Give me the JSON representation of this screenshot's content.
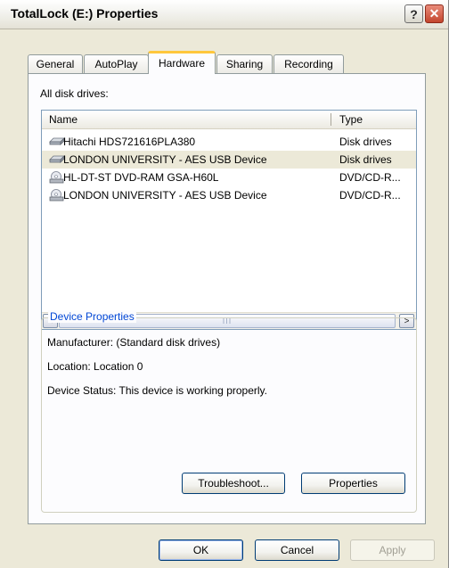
{
  "window": {
    "title": "TotalLock (E:) Properties"
  },
  "tabs": [
    {
      "label": "General"
    },
    {
      "label": "AutoPlay"
    },
    {
      "label": "Hardware"
    },
    {
      "label": "Sharing"
    },
    {
      "label": "Recording"
    }
  ],
  "active_tab": "Hardware",
  "drives": {
    "label": "All disk drives:",
    "columns": {
      "name": "Name",
      "type": "Type"
    },
    "rows": [
      {
        "name": "Hitachi HDS721616PLA380",
        "type": "Disk drives",
        "icon": "hard-disk-icon"
      },
      {
        "name": "LONDON UNIVERSITY - AES USB Device",
        "type": "Disk drives",
        "icon": "hard-disk-icon"
      },
      {
        "name": "HL-DT-ST DVD-RAM GSA-H60L",
        "type": "DVD/CD-R...",
        "icon": "cd-drive-icon"
      },
      {
        "name": "LONDON UNIVERSITY - AES USB Device",
        "type": "DVD/CD-R...",
        "icon": "cd-drive-icon"
      }
    ],
    "selected_row": 1,
    "scroll": {
      "left_arrow": "<",
      "right_arrow": ">",
      "grip": "III"
    }
  },
  "device_properties": {
    "legend": "Device Properties",
    "manufacturer": "Manufacturer: (Standard disk drives)",
    "location": "Location: Location 0",
    "status": "Device Status: This device is working properly.",
    "troubleshoot_label": "Troubleshoot...",
    "properties_label": "Properties"
  },
  "footer": {
    "ok": "OK",
    "cancel": "Cancel",
    "apply": "Apply"
  },
  "titlebar_buttons": {
    "help": "?",
    "close": "✕"
  },
  "colors": {
    "accent_tab": "#ffc73c",
    "group_legend": "#0046d5",
    "window_bg": "#ece9d8"
  }
}
